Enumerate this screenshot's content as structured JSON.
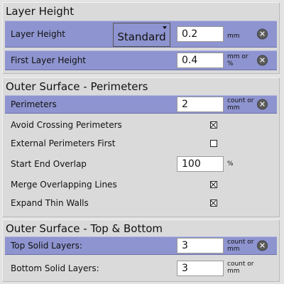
{
  "sections": {
    "layer_height": {
      "title": "Layer Height",
      "rows": {
        "layer_height": {
          "label": "Layer Height",
          "preset": "Standard",
          "value": "0.2",
          "unit": "mm"
        },
        "first_layer_height": {
          "label": "First Layer Height",
          "value": "0.4",
          "unit_line1": "mm or",
          "unit_line2": "%"
        }
      }
    },
    "perimeters": {
      "title": "Outer Surface - Perimeters",
      "rows": {
        "perimeters": {
          "label": "Perimeters",
          "value": "2",
          "unit_line1": "count or",
          "unit_line2": "mm"
        },
        "avoid_crossing": {
          "label": "Avoid Crossing Perimeters",
          "checked": true
        },
        "external_first": {
          "label": "External Perimeters First",
          "checked": false
        },
        "start_end_overlap": {
          "label": "Start End Overlap",
          "value": "100",
          "unit": "%"
        },
        "merge_overlapping": {
          "label": "Merge Overlapping Lines",
          "checked": true
        },
        "expand_thin_walls": {
          "label": "Expand Thin Walls",
          "checked": true
        }
      }
    },
    "top_bottom": {
      "title": "Outer Surface - Top & Bottom",
      "rows": {
        "top_solid": {
          "label": "Top Solid Layers:",
          "value": "3",
          "unit_line1": "count or",
          "unit_line2": "mm"
        },
        "bottom_solid": {
          "label": "Bottom Solid Layers:",
          "value": "3",
          "unit_line1": "count or",
          "unit_line2": "mm"
        }
      }
    }
  },
  "colors": {
    "highlight": "#8e94cf",
    "panel": "#dadada",
    "background": "#e3e3e3"
  },
  "icons": {
    "reset": "close-circle-icon",
    "checked": "checkbox-checked-icon",
    "unchecked": "checkbox-unchecked-icon"
  }
}
